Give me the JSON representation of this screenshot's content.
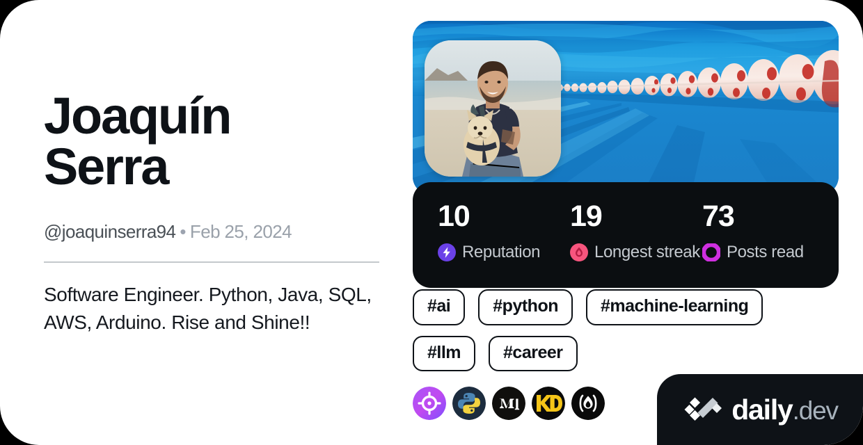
{
  "card": {
    "background_color": "#ffffff",
    "page_background_color": "#000000"
  },
  "profile": {
    "name": "Joaquín Serra",
    "name_line_1": "Joaquín",
    "name_line_2": "Serra",
    "handle": "@joaquinserra94",
    "separator": "•",
    "joined_date": "Feb 25, 2024",
    "bio": "Software Engineer. Python, Java, SQL, AWS, Arduino. Rise and Shine!!",
    "avatar_alt": "man holding a small dog at the beach",
    "cover_alt": "underwater view of a swimming pool with red and white lane dividers"
  },
  "stats": [
    {
      "value": "10",
      "label": "Reputation",
      "icon": "bolt-icon",
      "icon_color": "#6b41e8"
    },
    {
      "value": "19",
      "label": "Longest streak",
      "icon": "flame-icon",
      "icon_color": "#f8557e"
    },
    {
      "value": "73",
      "label": "Posts read",
      "icon": "ring-icon",
      "icon_color": "#cf2fe0"
    }
  ],
  "tags": [
    {
      "label": "#ai"
    },
    {
      "label": "#python"
    },
    {
      "label": "#machine-learning"
    },
    {
      "label": "#llm"
    },
    {
      "label": "#career"
    }
  ],
  "sources": [
    {
      "name": "crosshair-target-icon",
      "accent": "#b44bf0"
    },
    {
      "name": "python-logo-icon",
      "accent": "#ffd544"
    },
    {
      "name": "medium-logo-icon",
      "accent": "#ffffff"
    },
    {
      "name": "kdnuggets-logo-icon",
      "accent": "#f5c518"
    },
    {
      "name": "flame-badge-icon",
      "accent": "#ffffff"
    }
  ],
  "brand": {
    "name_bold": "daily",
    "name_light": ".dev",
    "logo_icon": "daily-dev-logo-icon",
    "background_color": "#0e1217"
  }
}
